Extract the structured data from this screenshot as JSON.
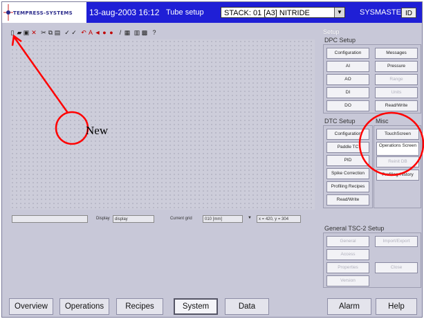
{
  "title_bar": {
    "logo_text": "TEMPRESS-SYSTEMS",
    "datetime": "13-aug-2003 16:12",
    "screen_name": "Tube setup",
    "stack_value": "STACK: 01 [A3] NITRIDE",
    "user": "SYSMASTER",
    "id_button": "ID",
    "background_color": "#1f1fd6"
  },
  "toolbar": {
    "icons": [
      {
        "name": "new-icon",
        "glyph": "▯"
      },
      {
        "name": "open-icon",
        "glyph": "▰"
      },
      {
        "name": "save-icon",
        "glyph": "▣"
      },
      {
        "name": "delete-icon",
        "glyph": "✕"
      },
      {
        "name": "cut-icon",
        "glyph": "✂"
      },
      {
        "name": "copy-icon",
        "glyph": "⧉"
      },
      {
        "name": "paste-icon",
        "glyph": "▤"
      },
      {
        "name": "check-icon",
        "glyph": "✓"
      },
      {
        "name": "check-all-icon",
        "glyph": "✓"
      },
      {
        "name": "undo-icon",
        "glyph": "↶"
      },
      {
        "name": "text-a-icon",
        "glyph": "A"
      },
      {
        "name": "valve-icon",
        "glyph": "◄"
      },
      {
        "name": "record-icon",
        "glyph": "●"
      },
      {
        "name": "record-2-icon",
        "glyph": "●"
      },
      {
        "name": "wand-icon",
        "glyph": "/"
      },
      {
        "name": "grid-icon",
        "glyph": "▦"
      },
      {
        "name": "print-icon",
        "glyph": "▥"
      },
      {
        "name": "image-icon",
        "glyph": "▩"
      },
      {
        "name": "help-icon",
        "glyph": "?"
      }
    ]
  },
  "status_row": {
    "message_value": "",
    "display_label": "Display",
    "display_value": "display",
    "grid_label": "Current grid",
    "grid_value": "010 [mm]",
    "coords": "x = 420, y = 304"
  },
  "panel": {
    "title": "Setup",
    "dpc": {
      "label": "DPC Setup",
      "buttons": [
        {
          "label": "Configuration",
          "enabled": true
        },
        {
          "label": "Messages",
          "enabled": true
        },
        {
          "label": "AI",
          "enabled": true
        },
        {
          "label": "Pressure",
          "enabled": true
        },
        {
          "label": "AO",
          "enabled": true
        },
        {
          "label": "Range",
          "enabled": false
        },
        {
          "label": "DI",
          "enabled": true
        },
        {
          "label": "Units",
          "enabled": false
        },
        {
          "label": "DO",
          "enabled": true
        },
        {
          "label": "Read/Write",
          "enabled": true
        }
      ]
    },
    "dtc": {
      "label": "DTC Setup",
      "buttons": [
        {
          "label": "Configuration",
          "enabled": true
        },
        {
          "label": "Paddle TC",
          "enabled": true
        },
        {
          "label": "PID",
          "enabled": true
        },
        {
          "label": "Spike Correction",
          "enabled": true
        },
        {
          "label": "Profiling Recipes",
          "enabled": true
        },
        {
          "label": "Read/Write",
          "enabled": true
        }
      ]
    },
    "misc": {
      "label": "Misc",
      "buttons": [
        {
          "label": "TouchScreen",
          "enabled": true
        },
        {
          "label": "Operations Screen",
          "enabled": true
        },
        {
          "label": "Reinit DB",
          "enabled": false
        },
        {
          "label": "Profiling History",
          "enabled": true
        }
      ]
    },
    "general": {
      "label": "General TSC-2 Setup",
      "buttons": [
        {
          "label": "General",
          "enabled": false
        },
        {
          "label": "Import/Export",
          "enabled": false
        },
        {
          "label": "Access",
          "enabled": false
        },
        {
          "label": "Properties",
          "enabled": false
        },
        {
          "label": "Close",
          "enabled": false
        },
        {
          "label": "Version",
          "enabled": false
        }
      ]
    }
  },
  "nav": {
    "buttons": [
      {
        "label": "Overview",
        "active": false
      },
      {
        "label": "Operations",
        "active": false
      },
      {
        "label": "Recipes",
        "active": false
      },
      {
        "label": "System",
        "active": true
      },
      {
        "label": "Data",
        "active": false
      },
      {
        "label": "Alarm",
        "active": false
      },
      {
        "label": "Help",
        "active": false
      }
    ]
  },
  "annotations": {
    "new_label": "New",
    "color": "#ff0000"
  }
}
